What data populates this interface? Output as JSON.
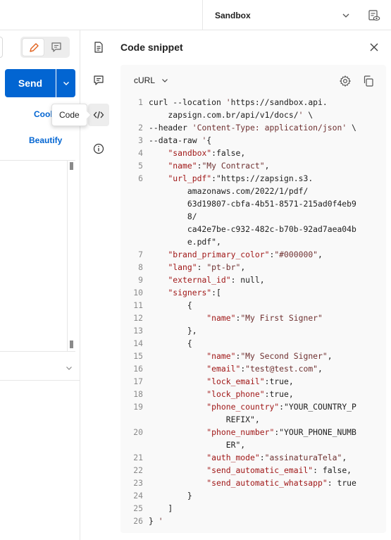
{
  "header": {
    "environment": "Sandbox"
  },
  "request": {
    "send_label": "Send",
    "cookies_label": "Cool",
    "beautify_label": "Beautify"
  },
  "rail": {
    "tooltip": "Code"
  },
  "panel": {
    "title": "Code snippet",
    "language": "cURL"
  },
  "code_lines": [
    {
      "n": "1",
      "t": "curl --location 'https://sandbox.api."
    },
    {
      "n": "",
      "t": "    zapsign.com.br/api/v1/docs/' \\"
    },
    {
      "n": "2",
      "t": "--header 'Content-Type: application/json' \\"
    },
    {
      "n": "3",
      "t": "--data-raw '{"
    },
    {
      "n": "4",
      "t": "    \"sandbox\":false,"
    },
    {
      "n": "5",
      "t": "    \"name\":\"My Contract\","
    },
    {
      "n": "6",
      "t": "    \"url_pdf\":\"https://zapsign.s3."
    },
    {
      "n": "",
      "t": "        amazonaws.com/2022/1/pdf/"
    },
    {
      "n": "",
      "t": "        63d19807-cbfa-4b51-8571-215ad0f4eb9"
    },
    {
      "n": "",
      "t": "        8/"
    },
    {
      "n": "",
      "t": "        ca42e7be-c932-482c-b70b-92ad7aea04b"
    },
    {
      "n": "",
      "t": "        e.pdf\","
    },
    {
      "n": "7",
      "t": "    \"brand_primary_color\":\"#000000\","
    },
    {
      "n": "8",
      "t": "    \"lang\": \"pt-br\","
    },
    {
      "n": "9",
      "t": "    \"external_id\": null,"
    },
    {
      "n": "10",
      "t": "    \"signers\":["
    },
    {
      "n": "11",
      "t": "        {"
    },
    {
      "n": "12",
      "t": "            \"name\":\"My First Signer\""
    },
    {
      "n": "13",
      "t": "        },"
    },
    {
      "n": "14",
      "t": "        {"
    },
    {
      "n": "15",
      "t": "            \"name\":\"My Second Signer\","
    },
    {
      "n": "16",
      "t": "            \"email\":\"test@test.com\","
    },
    {
      "n": "17",
      "t": "            \"lock_email\":true,"
    },
    {
      "n": "18",
      "t": "            \"lock_phone\":true,"
    },
    {
      "n": "19",
      "t": "            \"phone_country\":\"YOUR_COUNTRY_P"
    },
    {
      "n": "",
      "t": "                REFIX\","
    },
    {
      "n": "20",
      "t": "            \"phone_number\":\"YOUR_PHONE_NUMB"
    },
    {
      "n": "",
      "t": "                ER\","
    },
    {
      "n": "21",
      "t": "            \"auth_mode\":\"assinaturaTela\","
    },
    {
      "n": "22",
      "t": "            \"send_automatic_email\": false,"
    },
    {
      "n": "23",
      "t": "            \"send_automatic_whatsapp\": true"
    },
    {
      "n": "24",
      "t": "        }"
    },
    {
      "n": "25",
      "t": "    ]"
    },
    {
      "n": "26",
      "t": "} '"
    }
  ]
}
